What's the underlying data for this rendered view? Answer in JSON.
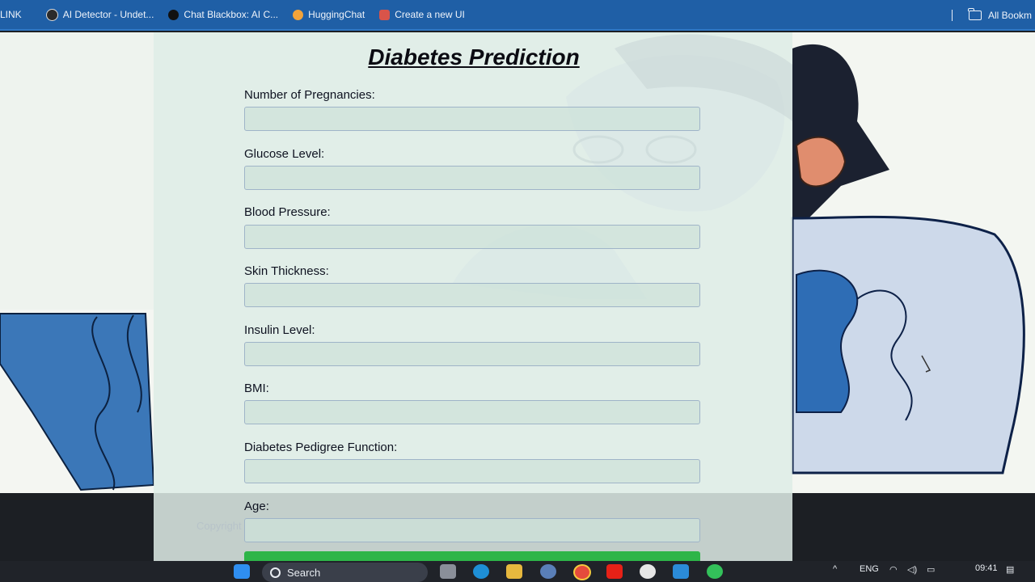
{
  "bookmarks": [
    {
      "label": "LINK",
      "icon": "link-icon",
      "color": ""
    },
    {
      "label": "AI Detector - Undet...",
      "icon": "ai-detector-icon",
      "color": "#2b2b2b"
    },
    {
      "label": "Chat Blackbox: AI C...",
      "icon": "blackbox-icon",
      "color": "#111111"
    },
    {
      "label": "HuggingChat",
      "icon": "hugging-face-icon",
      "color": "#f2a33a"
    },
    {
      "label": "Create a new UI",
      "icon": "ui-icon",
      "color": "#d9544a"
    }
  ],
  "bookmarks_right": {
    "label": "All Bookm",
    "icon": "folder-icon"
  },
  "form": {
    "title": "Diabetes Prediction",
    "fields": [
      {
        "label": "Number of Pregnancies:",
        "value": ""
      },
      {
        "label": "Glucose Level:",
        "value": ""
      },
      {
        "label": "Blood Pressure:",
        "value": ""
      },
      {
        "label": "Skin Thickness:",
        "value": ""
      },
      {
        "label": "Insulin Level:",
        "value": ""
      },
      {
        "label": "BMI:",
        "value": ""
      },
      {
        "label": "Diabetes Pedigree Function:",
        "value": ""
      },
      {
        "label": "Age:",
        "value": ""
      }
    ],
    "submit_color": "#2eb548",
    "footer": "Copyright"
  },
  "taskbar": {
    "search_label": "Search",
    "language": "ENG",
    "time": "09:41"
  },
  "colors": {
    "bookmark_bar": "#1f5fa6",
    "taskbar": "#202329",
    "accent_blue": "#2f77c4"
  }
}
